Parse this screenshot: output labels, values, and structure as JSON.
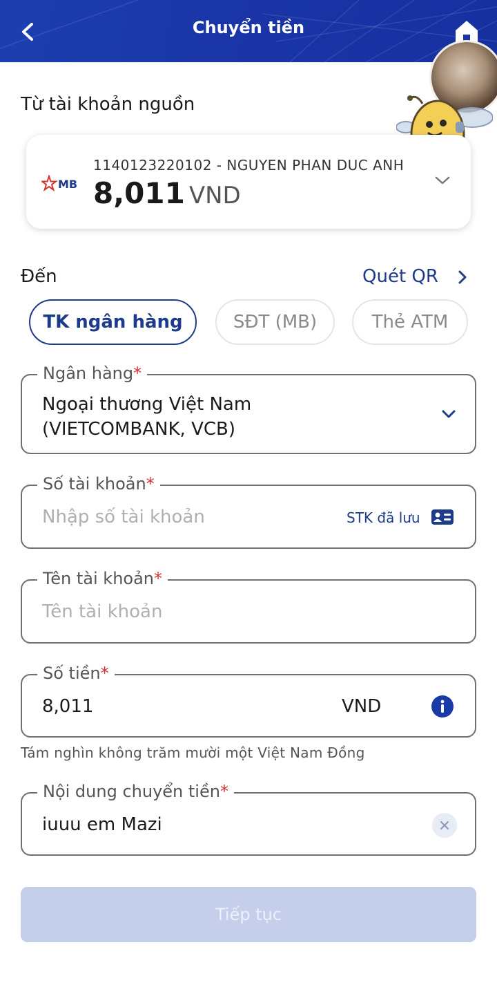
{
  "header": {
    "title": "Chuyển tiền"
  },
  "source": {
    "label": "Từ tài khoản nguồn",
    "bank_logo": "MB",
    "account_line": "1140123220102 - NGUYEN PHAN DUC ANH",
    "balance": "8,011",
    "currency": "VND"
  },
  "destination": {
    "label": "Đến",
    "qr_link": "Quét QR",
    "tabs": [
      {
        "label": "TK ngân hàng",
        "active": true
      },
      {
        "label": "SĐT (MB)",
        "active": false
      },
      {
        "label": "Thẻ ATM",
        "active": false
      }
    ]
  },
  "form": {
    "bank": {
      "label": "Ngân hàng",
      "value_line1": "Ngoại thương Việt Nam",
      "value_line2": "(VIETCOMBANK, VCB)"
    },
    "account_number": {
      "label": "Số tài khoản",
      "placeholder": "Nhập số tài khoản",
      "saved_link": "STK đã lưu"
    },
    "account_name": {
      "label": "Tên tài khoản",
      "placeholder": "Tên tài khoản"
    },
    "amount": {
      "label": "Số tiền",
      "value": "8,011",
      "currency": "VND",
      "in_words": "Tám nghìn không trăm mười một Việt Nam Đồng"
    },
    "content": {
      "label": "Nội dung chuyển tiền",
      "value": "iuuu em Mazi"
    },
    "required_mark": "*"
  },
  "actions": {
    "continue": "Tiếp tục"
  },
  "colors": {
    "primary": "#1e3a8a",
    "header": "#1c3fb0",
    "required": "#d0342c",
    "button_disabled": "#c5cfeb"
  },
  "icons": [
    "back-arrow-icon",
    "home-icon",
    "chevron-down-icon",
    "chevron-right-icon",
    "contact-card-icon",
    "info-icon",
    "close-icon"
  ]
}
